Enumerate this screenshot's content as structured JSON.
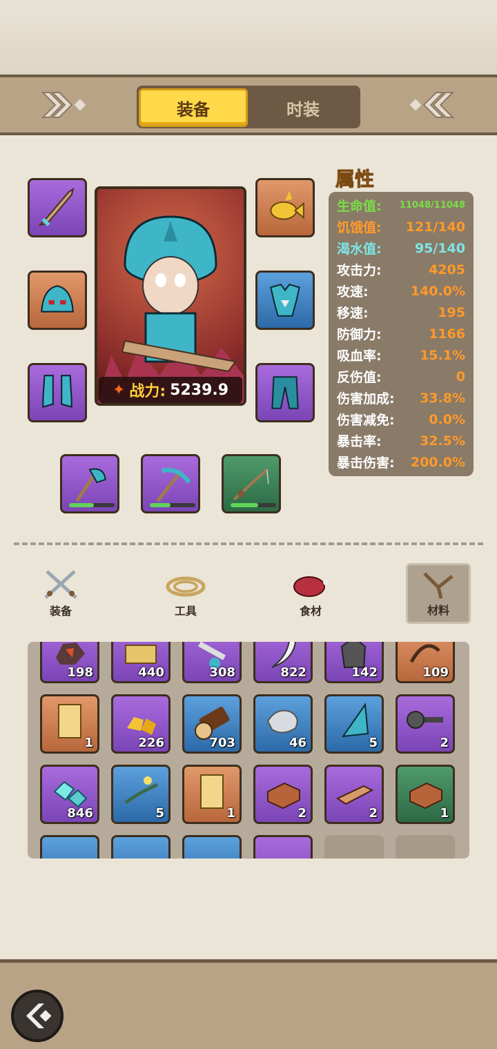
{
  "header": {
    "tabs": [
      {
        "label": "装备",
        "active": true
      },
      {
        "label": "时装",
        "active": false
      }
    ]
  },
  "character": {
    "power_label": "战力:",
    "power_value": "5239.9"
  },
  "attributes": {
    "title": "属性",
    "rows": [
      {
        "label": "生命值:",
        "value": "11048/11048"
      },
      {
        "label": "饥饿值:",
        "value": "121/140"
      },
      {
        "label": "渴水值:",
        "value": "95/140"
      },
      {
        "label": "攻击力:",
        "value": "4205"
      },
      {
        "label": "攻速:",
        "value": "140.0%"
      },
      {
        "label": "移速:",
        "value": "195"
      },
      {
        "label": "防御力:",
        "value": "1166"
      },
      {
        "label": "吸血率:",
        "value": "15.1%"
      },
      {
        "label": "反伤值:",
        "value": "0"
      },
      {
        "label": "伤害加成:",
        "value": "33.8%"
      },
      {
        "label": "伤害减免:",
        "value": "0.0%"
      },
      {
        "label": "暴击率:",
        "value": "32.5%"
      },
      {
        "label": "暴击伤害:",
        "value": "200.0%"
      }
    ]
  },
  "tools": [
    {
      "name": "axe",
      "durability": 0.55
    },
    {
      "name": "pickaxe",
      "durability": 0.45
    },
    {
      "name": "fishing-rod",
      "durability": 0.6
    }
  ],
  "categories": [
    {
      "label": "装备",
      "active": false
    },
    {
      "label": "工具",
      "active": false
    },
    {
      "label": "食材",
      "active": false
    },
    {
      "label": "材料",
      "active": true
    }
  ],
  "inventory": {
    "row1": [
      {
        "count": "198",
        "rarity": "purple",
        "icon": "ore-icon"
      },
      {
        "count": "440",
        "rarity": "purple",
        "icon": "wood-plank-icon"
      },
      {
        "count": "308",
        "rarity": "purple",
        "icon": "bone-icon"
      },
      {
        "count": "822",
        "rarity": "purple",
        "icon": "fang-icon"
      },
      {
        "count": "142",
        "rarity": "purple",
        "icon": "rock-icon"
      },
      {
        "count": "109",
        "rarity": "orange",
        "icon": "rope-icon"
      }
    ],
    "row2": [
      {
        "count": "1",
        "rarity": "orange",
        "icon": "scroll-icon"
      },
      {
        "count": "226",
        "rarity": "purple",
        "icon": "gold-nugget-icon"
      },
      {
        "count": "703",
        "rarity": "blue",
        "icon": "log-icon"
      },
      {
        "count": "46",
        "rarity": "blue",
        "icon": "silver-ore-icon"
      },
      {
        "count": "5",
        "rarity": "blue",
        "icon": "fin-icon"
      },
      {
        "count": "2",
        "rarity": "purple",
        "icon": "nail-icon"
      }
    ],
    "row3": [
      {
        "count": "846",
        "rarity": "purple",
        "icon": "crystal-icon"
      },
      {
        "count": "5",
        "rarity": "blue",
        "icon": "herb-icon"
      },
      {
        "count": "1",
        "rarity": "orange",
        "icon": "scroll-icon"
      },
      {
        "count": "2",
        "rarity": "purple",
        "icon": "brick-icon"
      },
      {
        "count": "2",
        "rarity": "purple",
        "icon": "plank-icon"
      },
      {
        "count": "1",
        "rarity": "green",
        "icon": "brick-icon"
      }
    ]
  }
}
